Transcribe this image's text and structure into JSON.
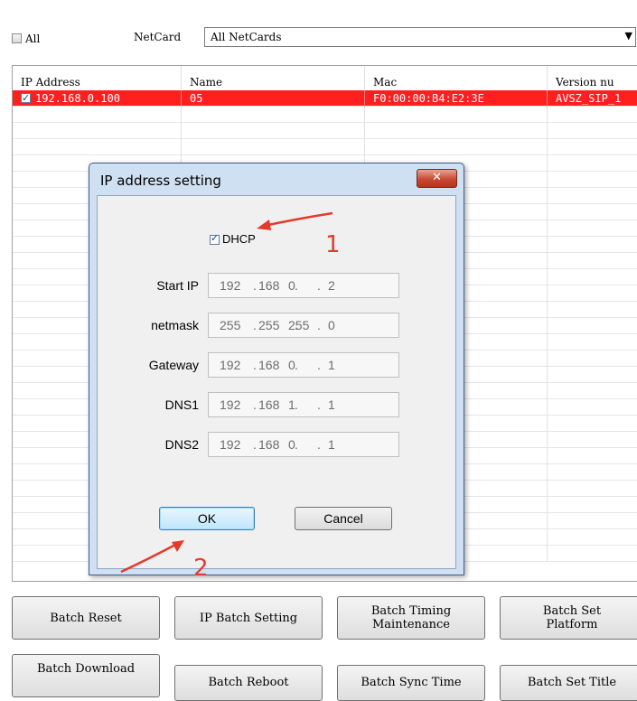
{
  "toolbar": {
    "all_label": "All",
    "netcard_label": "NetCard",
    "netcard_value": "All NetCards"
  },
  "table": {
    "columns": [
      "IP Address",
      "Name",
      "Mac",
      "Version nu"
    ],
    "rows": [
      {
        "ip": "192.168.0.100",
        "name": "05",
        "mac": "F0:00:00:B4:E2:3E",
        "version": "AVSZ_SIP_1",
        "checked": true,
        "selected": true
      }
    ]
  },
  "dialog": {
    "title": "IP address setting",
    "close_label": "✕",
    "dhcp_label": "DHCP",
    "dhcp_checked": true,
    "fields": [
      {
        "label": "Start IP",
        "octets": [
          "192",
          "168",
          "0",
          "2"
        ]
      },
      {
        "label": "netmask",
        "octets": [
          "255",
          "255",
          "255",
          "0"
        ]
      },
      {
        "label": "Gateway",
        "octets": [
          "192",
          "168",
          "0",
          "1"
        ]
      },
      {
        "label": "DNS1",
        "octets": [
          "192",
          "168",
          "1",
          "1"
        ]
      },
      {
        "label": "DNS2",
        "octets": [
          "192",
          "168",
          "0",
          "1"
        ]
      }
    ],
    "ok_label": "OK",
    "cancel_label": "Cancel"
  },
  "buttons": {
    "batch_reset": "Batch Reset",
    "ip_batch_setting": "IP Batch Setting",
    "batch_timing": "Batch Timing\nMaintenance",
    "batch_set_platform": "Batch Set\nPlatform",
    "batch_download": "Batch Download",
    "batch_reboot": "Batch Reboot",
    "batch_sync_time": "Batch Sync Time",
    "batch_set_title": "Batch Set Title"
  },
  "annotations": {
    "step1": "1",
    "step2": "2",
    "color": "#e53a2b"
  },
  "colors": {
    "selected_row": "#ff1f1f",
    "dialog_frame": "#cfe0f3",
    "close_button": "#c74a33"
  }
}
